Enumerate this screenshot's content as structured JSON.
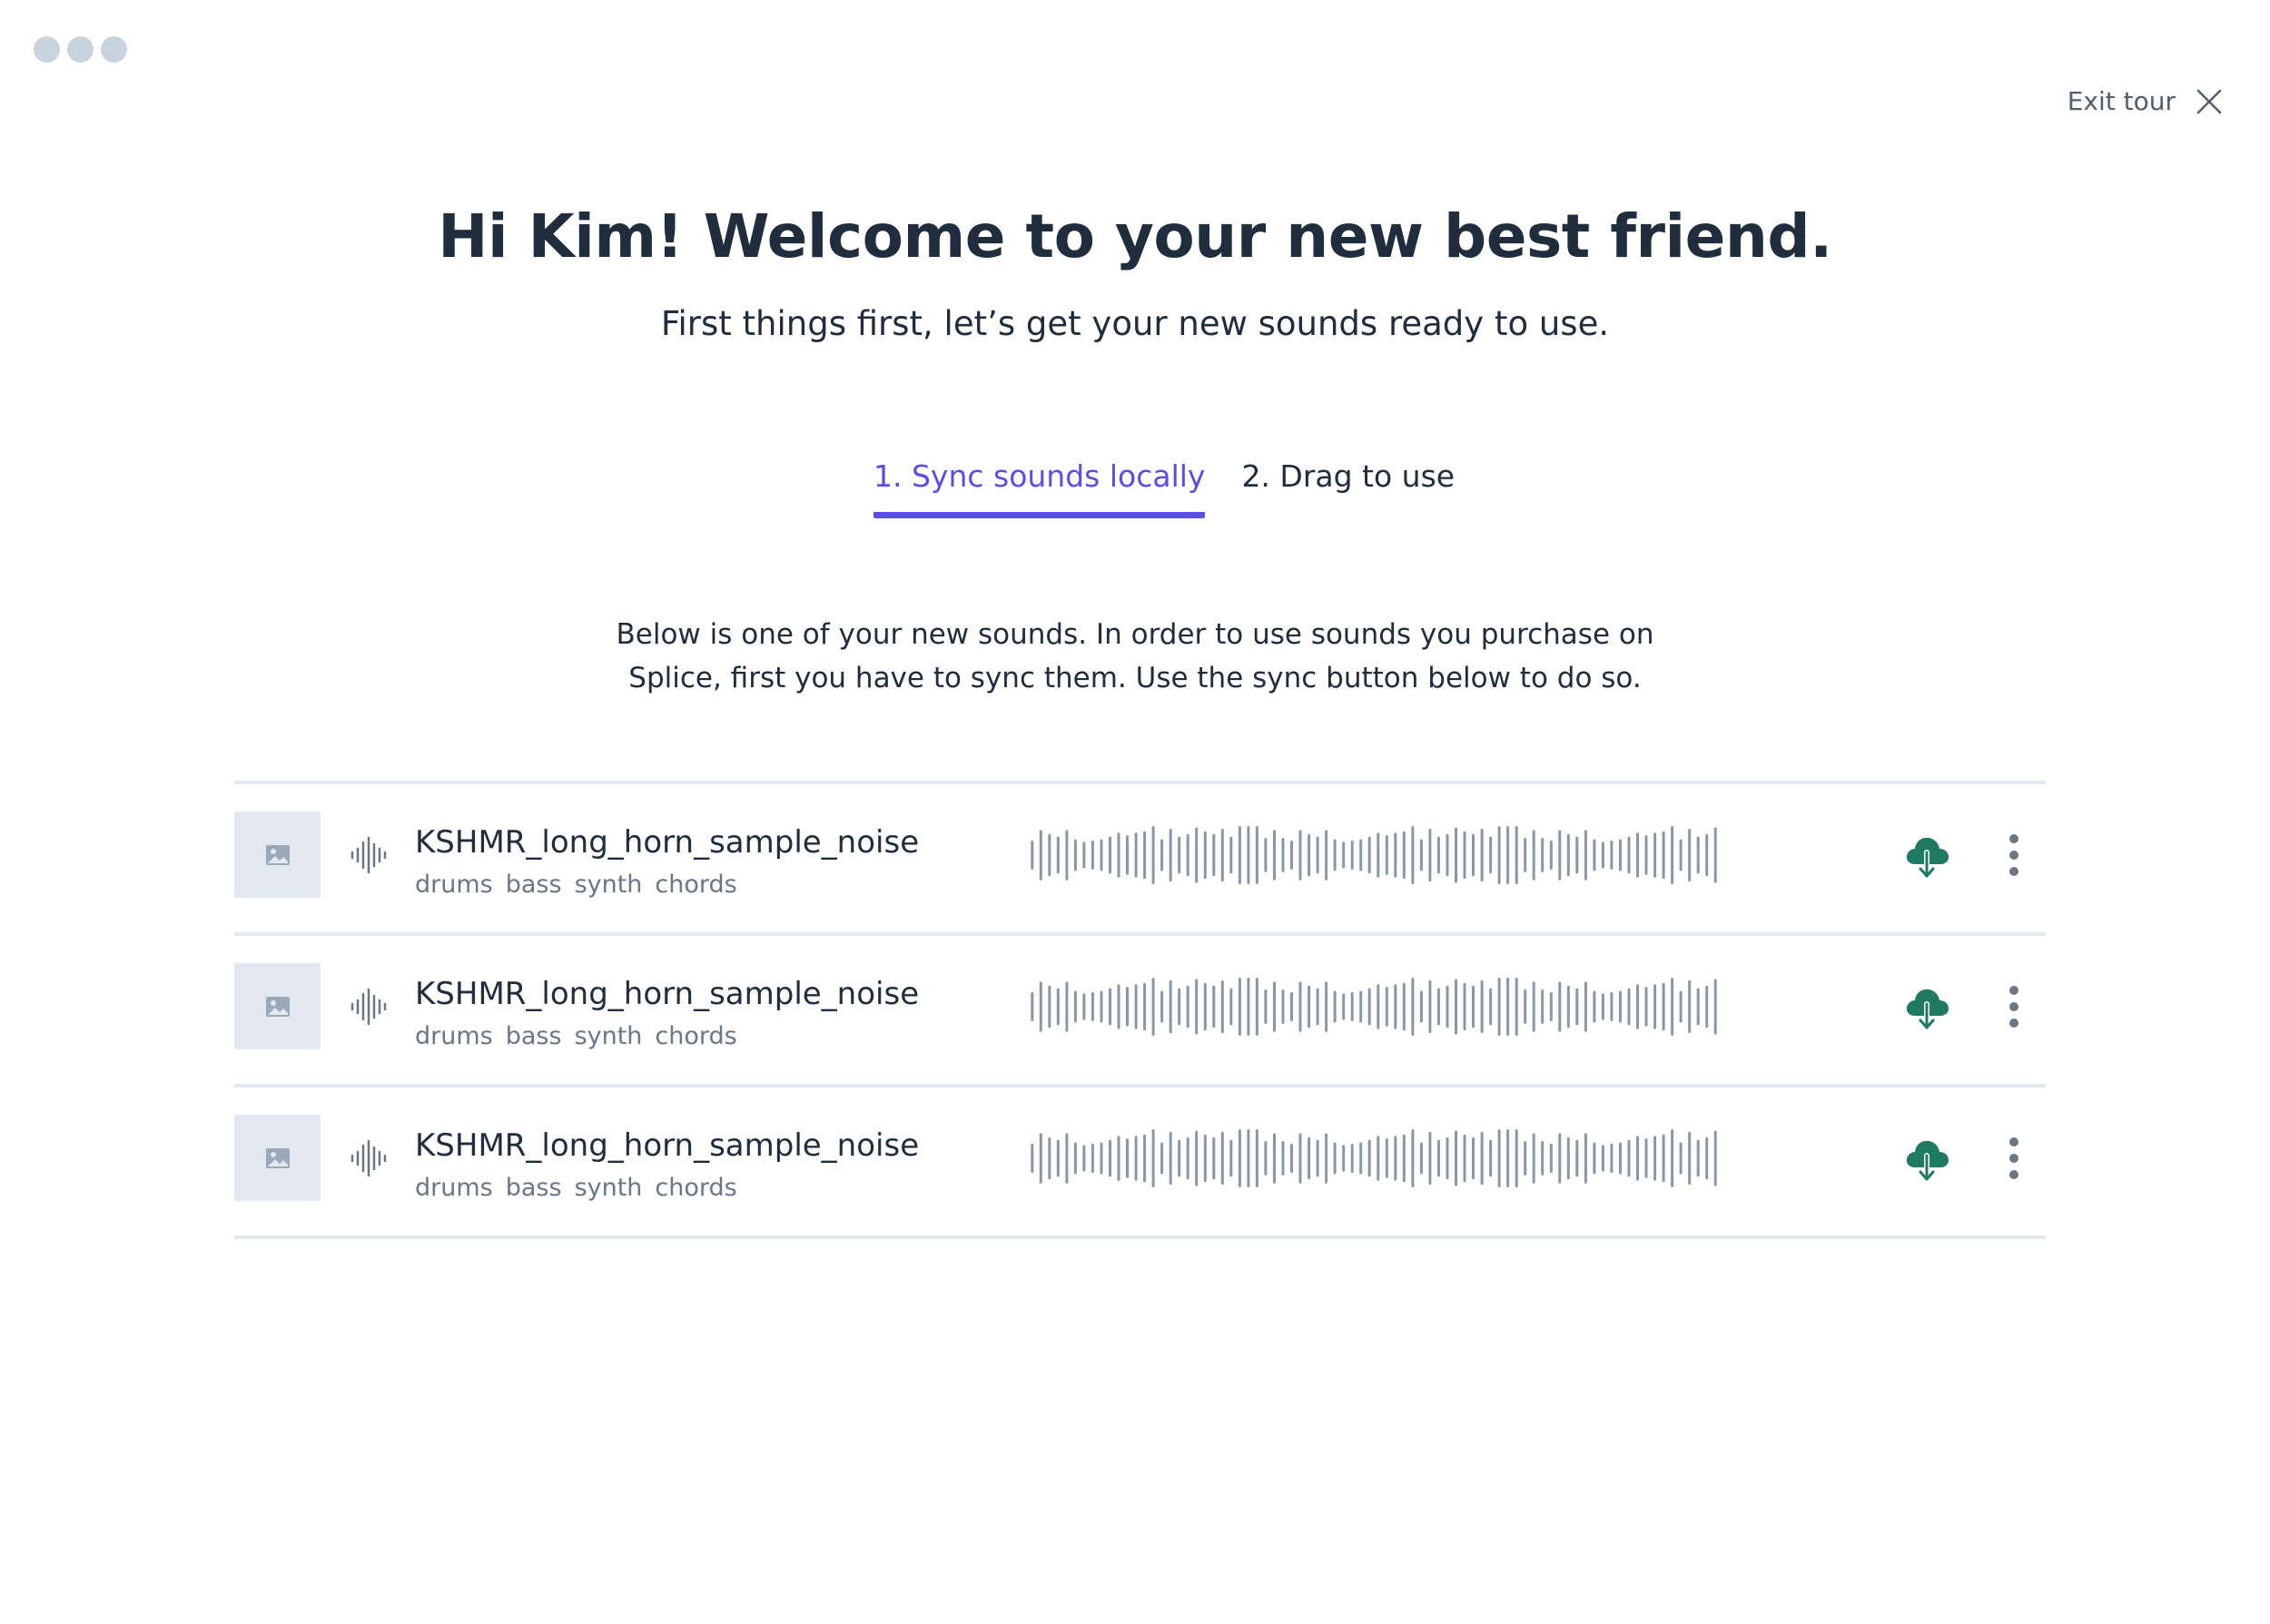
{
  "header": {
    "exit_label": "Exit tour",
    "title": "Hi Kim! Welcome to your new best friend.",
    "subtitle": "First things first, let’s get your new sounds ready to use."
  },
  "tabs": [
    {
      "label": "1. Sync sounds locally",
      "active": true
    },
    {
      "label": "2. Drag to use",
      "active": false
    }
  ],
  "description": {
    "line1": "Below is one of your new sounds. In order to use sounds you purchase on",
    "line2": "Splice, first you have to sync them. Use the sync button below to do so."
  },
  "sounds": [
    {
      "name": "KSHMR_long_horn_sample_noise",
      "tags": [
        "drums",
        "bass",
        "synth",
        "chords"
      ]
    },
    {
      "name": "KSHMR_long_horn_sample_noise",
      "tags": [
        "drums",
        "bass",
        "synth",
        "chords"
      ]
    },
    {
      "name": "KSHMR_long_horn_sample_noise",
      "tags": [
        "drums",
        "bass",
        "synth",
        "chords"
      ]
    }
  ],
  "icons": {
    "window_controls": "window-dots-icon",
    "exit": "close-icon",
    "thumbnail": "image-placeholder-icon",
    "waveform": "waveform-icon",
    "sync": "cloud-download-icon",
    "more": "more-vertical-icon"
  },
  "colors": {
    "accent": "#5b4ee6",
    "sync": "#1e7a63",
    "text": "#1f2d3d",
    "muted": "#6b7785",
    "waveform": "#8a97a5",
    "divider": "#e4e9ee"
  }
}
